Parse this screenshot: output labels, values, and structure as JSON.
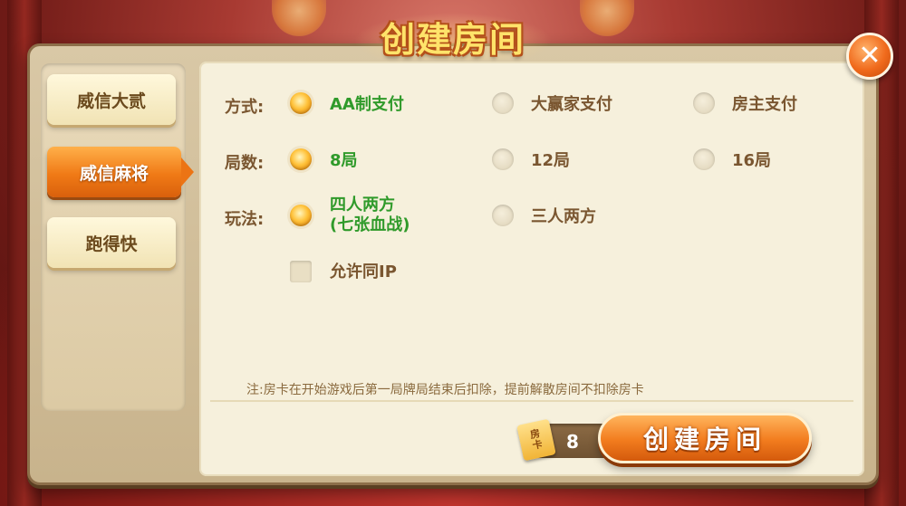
{
  "title": "创建房间",
  "close": {
    "icon": "close-icon",
    "glyph": "✕"
  },
  "tabs": [
    {
      "label": "威信大贰",
      "active": false
    },
    {
      "label": "威信麻将",
      "active": true
    },
    {
      "label": "跑得快",
      "active": false
    }
  ],
  "options": {
    "payment": {
      "label": "方式:",
      "choices": [
        {
          "label": "AA制支付",
          "selected": true
        },
        {
          "label": "大赢家支付",
          "selected": false
        },
        {
          "label": "房主支付",
          "selected": false
        }
      ]
    },
    "rounds": {
      "label": "局数:",
      "choices": [
        {
          "label": "8局",
          "selected": true
        },
        {
          "label": "12局",
          "selected": false
        },
        {
          "label": "16局",
          "selected": false
        }
      ]
    },
    "mode": {
      "label": "玩法:",
      "choices": [
        {
          "label": "四人两方",
          "label2": "(七张血战)",
          "selected": true
        },
        {
          "label": "三人两方",
          "selected": false
        }
      ]
    },
    "allow_same_ip": {
      "label": "允许同IP",
      "checked": false
    }
  },
  "note": "注:房卡在开始游戏后第一局牌局结束后扣除，提前解散房间不扣除房卡",
  "room_card": {
    "icon_text_1": "房",
    "icon_text_2": "卡",
    "count": "8"
  },
  "create_button": "创建房间",
  "colors": {
    "accent": "#f27c1e",
    "selected_text": "#2f9a2a",
    "panel": "#f6f0dc"
  }
}
